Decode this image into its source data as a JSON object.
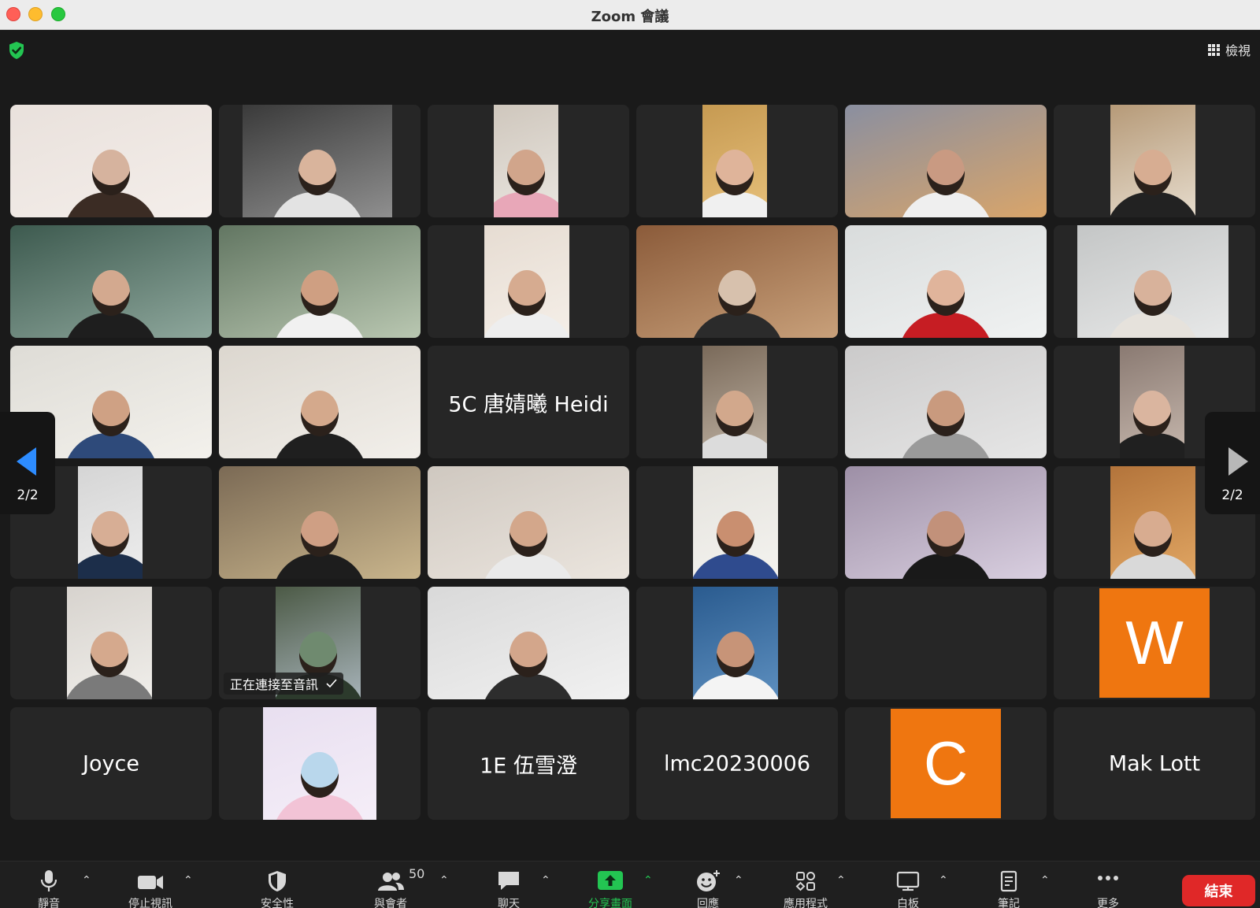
{
  "window": {
    "title": "Zoom 會議"
  },
  "header": {
    "view_label": "檢視"
  },
  "tiles": [
    {
      "name": "",
      "avatar": "",
      "status": "",
      "theme": [
        "#e9e1dc",
        "#f4eeea",
        "#d6b39e",
        "#3b2c24"
      ]
    },
    {
      "name": "",
      "avatar": "",
      "status": "",
      "theme": [
        "#3a3a3a",
        "#8f8f8f",
        "#d9b49c",
        "#e3e3e3"
      ]
    },
    {
      "name": "",
      "avatar": "",
      "status": "",
      "theme": [
        "#cfc7bd",
        "#eae6e0",
        "#d1a58b",
        "#e8a7b8"
      ]
    },
    {
      "name": "",
      "avatar": "",
      "status": "",
      "theme": [
        "#c69a52",
        "#e7c07a",
        "#dfb49a",
        "#f0f0f0"
      ]
    },
    {
      "name": "",
      "avatar": "",
      "status": "",
      "theme": [
        "#8a8fa0",
        "#d9a56a",
        "#c99a82",
        "#efefef"
      ]
    },
    {
      "name": "",
      "avatar": "",
      "status": "",
      "theme": [
        "#b69a78",
        "#e6dccd",
        "#d7ad92",
        "#222222"
      ]
    },
    {
      "name": "",
      "avatar": "",
      "status": "",
      "theme": [
        "#3d5a4f",
        "#8ea79c",
        "#d3a98f",
        "#1e1e1e"
      ]
    },
    {
      "name": "",
      "avatar": "",
      "status": "",
      "theme": [
        "#627662",
        "#b9c7b1",
        "#cf9f82",
        "#f1f1f1"
      ]
    },
    {
      "name": "",
      "avatar": "",
      "status": "",
      "theme": [
        "#e6dcd2",
        "#f5efe8",
        "#d6ab90",
        "#eeeeee"
      ]
    },
    {
      "name": "",
      "avatar": "",
      "status": "",
      "theme": [
        "#8b5b3a",
        "#c8a07a",
        "#d7c1ad",
        "#2b2b2b"
      ]
    },
    {
      "name": "",
      "avatar": "",
      "status": "",
      "theme": [
        "#d9dcdc",
        "#f0f2f2",
        "#e0b49b",
        "#c61d23"
      ]
    },
    {
      "name": "",
      "avatar": "",
      "status": "",
      "theme": [
        "#c4c6c6",
        "#e7e8e8",
        "#d8b29b",
        "#e6e2dc"
      ]
    },
    {
      "name": "",
      "avatar": "",
      "status": "",
      "theme": [
        "#dedcd6",
        "#f3f1ec",
        "#cfa184",
        "#2e4a7a"
      ]
    },
    {
      "name": "",
      "avatar": "",
      "status": "",
      "theme": [
        "#dcd7cf",
        "#f2efea",
        "#d4a98c",
        "#1f1f1f"
      ]
    },
    {
      "name": "5C 唐婧曦 Heidi",
      "avatar": "",
      "status": "",
      "theme": []
    },
    {
      "name": "",
      "avatar": "",
      "status": "",
      "theme": [
        "#7a6a5a",
        "#bfb2a3",
        "#d2a88c",
        "#dcdcdc"
      ]
    },
    {
      "name": "",
      "avatar": "",
      "status": "",
      "theme": [
        "#cbcaca",
        "#e6e6e6",
        "#c99a7e",
        "#9a9a9a"
      ]
    },
    {
      "name": "",
      "avatar": "",
      "status": "",
      "theme": [
        "#8a7a72",
        "#c7b8ae",
        "#dab59f",
        "#202020"
      ]
    },
    {
      "name": "",
      "avatar": "",
      "status": "",
      "theme": [
        "#d5d5d5",
        "#eeeeee",
        "#d7ae95",
        "#1c2e4a"
      ]
    },
    {
      "name": "",
      "avatar": "",
      "status": "",
      "theme": [
        "#7b6a55",
        "#c9b58c",
        "#cf9f84",
        "#1d1d1d"
      ]
    },
    {
      "name": "",
      "avatar": "",
      "status": "",
      "theme": [
        "#cfc8c0",
        "#ebe5de",
        "#d3a78b",
        "#eaeaea"
      ]
    },
    {
      "name": "",
      "avatar": "",
      "status": "",
      "theme": [
        "#e4e2dd",
        "#f4f3ef",
        "#c98f70",
        "#2f4b8e"
      ]
    },
    {
      "name": "",
      "avatar": "",
      "status": "",
      "theme": [
        "#9d8fa6",
        "#d9cfe0",
        "#c2917a",
        "#191919"
      ]
    },
    {
      "name": "",
      "avatar": "",
      "status": "",
      "theme": [
        "#b3743b",
        "#e1a663",
        "#d8ac90",
        "#d9d9d9"
      ]
    },
    {
      "name": "",
      "avatar": "",
      "status": "",
      "theme": [
        "#d7d3ce",
        "#f0eeea",
        "#d5a98d",
        "#7a7a7a"
      ]
    },
    {
      "name": "",
      "avatar": "",
      "status": "正在連接至音訊",
      "theme": [
        "#4c5a46",
        "#a7b3b9",
        "#6f8a6f",
        "#2c3a2c"
      ]
    },
    {
      "name": "",
      "avatar": "",
      "status": "",
      "theme": [
        "#d9d9d9",
        "#f1f1f1",
        "#d3a68b",
        "#2d2d2d"
      ]
    },
    {
      "name": "",
      "avatar": "",
      "status": "",
      "theme": [
        "#2a5b8f",
        "#5d8fbf",
        "#c79478",
        "#f4f4f4"
      ]
    },
    {
      "name": "",
      "avatar": "",
      "status": "",
      "theme": [
        "#4d8fb5",
        "#8fc3dc",
        "#e88c2a",
        "#8a8a8a"
      ]
    },
    {
      "name": "",
      "avatar": "W",
      "status": "",
      "theme": []
    },
    {
      "name": "Joyce",
      "avatar": "",
      "status": "",
      "theme": []
    },
    {
      "name": "",
      "avatar": "",
      "status": "",
      "theme": [
        "#e8dff0",
        "#f5eef8",
        "#b9d7ec",
        "#f2c3d6"
      ]
    },
    {
      "name": "1E 伍雪澄",
      "avatar": "",
      "status": "",
      "theme": []
    },
    {
      "name": "lmc20230006",
      "avatar": "",
      "status": "",
      "theme": []
    },
    {
      "name": "",
      "avatar": "C",
      "status": "",
      "theme": []
    },
    {
      "name": "Mak Lott",
      "avatar": "",
      "status": "",
      "theme": []
    }
  ],
  "pager": {
    "left_label": "2/2",
    "right_label": "2/2"
  },
  "toolbar": {
    "mute_label": "靜音",
    "video_label": "停止視訊",
    "security_label": "安全性",
    "participants_label": "與會者",
    "participants_count": "50",
    "chat_label": "聊天",
    "share_label": "分享畫面",
    "reactions_label": "回應",
    "apps_label": "應用程式",
    "whiteboard_label": "白板",
    "notes_label": "筆記",
    "more_label": "更多",
    "end_label": "結束",
    "caret_symbol": "⌃"
  },
  "colors": {
    "accent_green": "#23c552",
    "end_red": "#e02828",
    "avatar_orange": "#ef7610",
    "pager_blue": "#2d8cff"
  }
}
